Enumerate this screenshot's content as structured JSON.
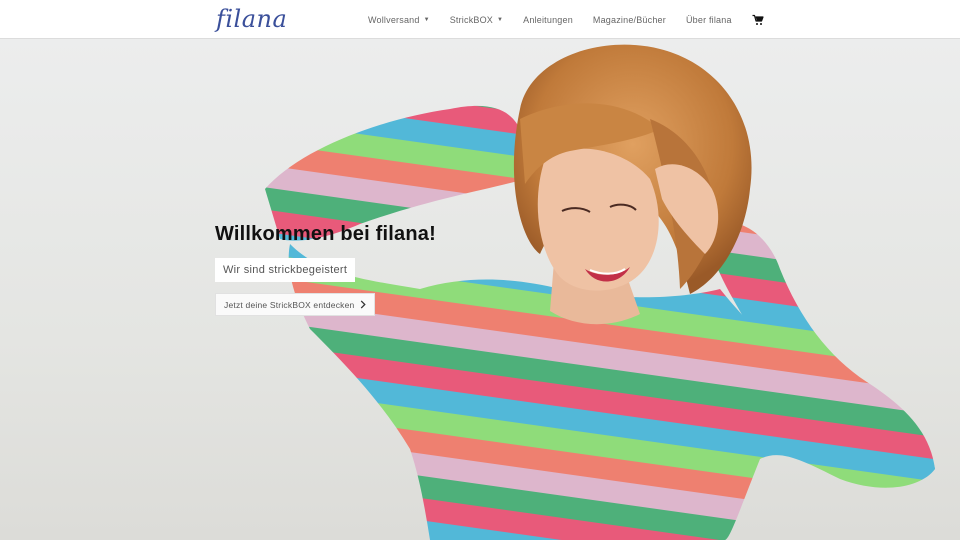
{
  "brand": {
    "logo_text": "filana",
    "accent_color": "#3a4f9a"
  },
  "nav": {
    "items": [
      {
        "label": "Wollversand",
        "has_dropdown": true
      },
      {
        "label": "StrickBOX",
        "has_dropdown": true
      },
      {
        "label": "Anleitungen",
        "has_dropdown": false
      },
      {
        "label": "Magazine/Bücher",
        "has_dropdown": false
      },
      {
        "label": "Über filana",
        "has_dropdown": false
      }
    ],
    "cart_icon": "shopping-cart-icon"
  },
  "hero": {
    "title": "Willkommen bei filana!",
    "subtitle": "Wir sind strickbegeistert",
    "cta_label": "Jetzt deine StrickBOX entdecken",
    "cta_icon": "chevron-right-icon"
  }
}
